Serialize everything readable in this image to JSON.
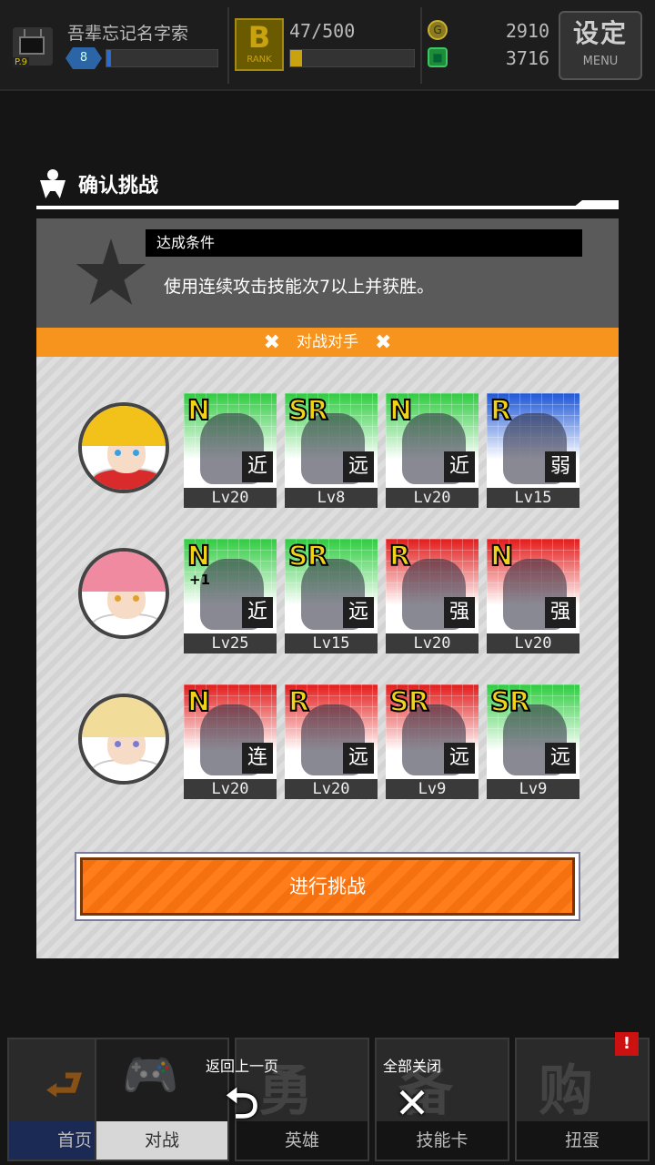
{
  "header": {
    "player_name": "吾辈忘记名字索",
    "player_level": "8",
    "tv_level": "P.9",
    "rank_letter": "B",
    "rank_word": "RANK",
    "rank_progress": "47/500",
    "rank_fraction": 0.094,
    "coins": "2910",
    "gems": "3716",
    "coin_icon": "coin-icon",
    "gem_icon": "gem-icon",
    "menu_label": "设定",
    "menu_sub": "MENU"
  },
  "modal": {
    "title": "确认挑战",
    "condition_label": "达成条件",
    "condition_text": "使用连续攻击技能次7以上并获胜。",
    "opponents_label": "对战对手",
    "opponents": [
      {
        "avatar": "avatar-blonde-headphones",
        "cards": [
          {
            "rarity": "N",
            "plus": "",
            "type": "近",
            "level": "Lv20",
            "color": "#2ecc40"
          },
          {
            "rarity": "SR",
            "plus": "",
            "type": "远",
            "level": "Lv8",
            "color": "#2ecc40"
          },
          {
            "rarity": "N",
            "plus": "",
            "type": "近",
            "level": "Lv20",
            "color": "#2ecc40"
          },
          {
            "rarity": "R",
            "plus": "",
            "type": "弱",
            "level": "Lv15",
            "color": "#1f57d6"
          }
        ]
      },
      {
        "avatar": "avatar-pink-twintails",
        "cards": [
          {
            "rarity": "N",
            "plus": "+1",
            "type": "近",
            "level": "Lv25",
            "color": "#2ecc40"
          },
          {
            "rarity": "SR",
            "plus": "",
            "type": "远",
            "level": "Lv15",
            "color": "#2ecc40"
          },
          {
            "rarity": "R",
            "plus": "",
            "type": "强",
            "level": "Lv20",
            "color": "#e41b1b"
          },
          {
            "rarity": "N",
            "plus": "",
            "type": "强",
            "level": "Lv20",
            "color": "#e41b1b"
          }
        ]
      },
      {
        "avatar": "avatar-blonde-maid",
        "cards": [
          {
            "rarity": "N",
            "plus": "",
            "type": "连",
            "level": "Lv20",
            "color": "#e41b1b"
          },
          {
            "rarity": "R",
            "plus": "",
            "type": "远",
            "level": "Lv20",
            "color": "#e41b1b"
          },
          {
            "rarity": "SR",
            "plus": "",
            "type": "远",
            "level": "Lv9",
            "color": "#e41b1b"
          },
          {
            "rarity": "SR",
            "plus": "",
            "type": "远",
            "level": "Lv9",
            "color": "#2ecc40"
          }
        ]
      }
    ],
    "start_button": "进行挑战"
  },
  "nav": {
    "items": [
      {
        "label": "首页",
        "icon": "home-arrow-icon"
      },
      {
        "label": "对战",
        "icon": "gamepad-icon"
      },
      {
        "label": "英雄",
        "icon": "hero-icon",
        "glyph": "勇"
      },
      {
        "label": "技能卡",
        "icon": "equip-icon",
        "glyph": "备"
      },
      {
        "label": "扭蛋",
        "icon": "gacha-icon",
        "glyph": "购",
        "badge": "!"
      }
    ],
    "back_label": "返回上一页",
    "close_all_label": "全部关闭"
  }
}
